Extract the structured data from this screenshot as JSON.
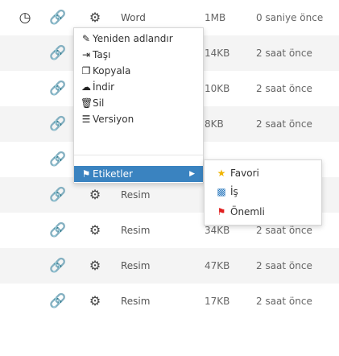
{
  "colors": {
    "accent": "#3a83c0",
    "star": "#f0b400",
    "briefcase": "#2f7bbf",
    "flag": "#e02020",
    "row_alt": "#f4f4f4"
  },
  "icons": {
    "history": "clock-icon",
    "share": "link-icon",
    "actions": "gears-icon"
  },
  "rows": [
    {
      "name": "Word",
      "size": "1MB",
      "date": "0 saniye önce"
    },
    {
      "name": "",
      "size": "14KB",
      "date": "2 saat önce"
    },
    {
      "name": "",
      "size": "10KB",
      "date": "2 saat önce"
    },
    {
      "name": "",
      "size": "8KB",
      "date": "2 saat önce"
    },
    {
      "name": "",
      "size": "",
      "date": ""
    },
    {
      "name": "Resim",
      "size": "",
      "date": ""
    },
    {
      "name": "Resim",
      "size": "34KB",
      "date": "2 saat önce"
    },
    {
      "name": "Resim",
      "size": "47KB",
      "date": "2 saat önce"
    },
    {
      "name": "Resim",
      "size": "17KB",
      "date": "2 saat önce"
    }
  ],
  "context_menu": {
    "items": [
      {
        "label": "Yeniden adlandır",
        "icon": "edit-icon"
      },
      {
        "label": "Taşı",
        "icon": "move-icon"
      },
      {
        "label": "Kopyala",
        "icon": "copy-icon"
      },
      {
        "label": "İndir",
        "icon": "cloud-download-icon"
      },
      {
        "label": "Sil",
        "icon": "trash-icon"
      },
      {
        "label": "Versiyon",
        "icon": "list-icon"
      }
    ],
    "active": {
      "label": "Etiketler",
      "icon": "tag-icon"
    }
  },
  "submenu": {
    "items": [
      {
        "label": "Favori",
        "icon": "star-icon"
      },
      {
        "label": "İş",
        "icon": "briefcase-icon"
      },
      {
        "label": "Önemli",
        "icon": "flag-icon"
      }
    ]
  }
}
